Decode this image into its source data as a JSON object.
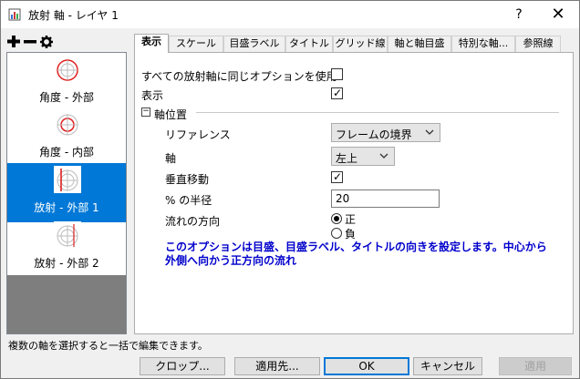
{
  "window": {
    "title": "放射 軸 - レイヤ 1",
    "help": "?",
    "close": "✕"
  },
  "toolbar": {
    "add": "+",
    "remove": "−",
    "settings": "⚙"
  },
  "left_items": [
    {
      "label": "角度 - 外部",
      "selected": false
    },
    {
      "label": "角度 - 内部",
      "selected": false
    },
    {
      "label": "放射 - 外部 1",
      "selected": true
    },
    {
      "label": "放射 - 外部 2",
      "selected": false
    }
  ],
  "tabs": [
    "表示",
    "スケール",
    "目盛ラベル",
    "タイトル",
    "グリッド線",
    "軸と軸目盛",
    "特別な軸...",
    "参照線"
  ],
  "active_tab": 0,
  "form": {
    "same_options_label": "すべての放射軸に同じオプションを使用",
    "same_options_checked": false,
    "show_label": "表示",
    "show_checked": true,
    "section_title": "軸位置",
    "section_toggle": "−",
    "reference_label": "リファレンス",
    "reference_value": "フレームの境界",
    "axis_label": "軸",
    "axis_value": "左上",
    "vertical_move_label": "垂直移動",
    "vertical_move_checked": true,
    "radius_label": "% の半径",
    "radius_value": "20",
    "flow_label": "流れの方向",
    "flow_positive": "正",
    "flow_negative": "負",
    "flow_selected": "positive",
    "note": "このオプションは目盛、目盛ラベル、タイトルの向きを設定します。中心から外側へ向かう正方向の流れ"
  },
  "status": "複数の軸を選択すると一括で編集できます。",
  "buttons": {
    "clop": "クロップ...",
    "apply_to": "適用先...",
    "ok": "OK",
    "cancel": "キャンセル",
    "apply": "適用"
  },
  "colors": {
    "selection": "#0078d7",
    "note": "#0000cc",
    "thumb_red": "#e02020"
  }
}
